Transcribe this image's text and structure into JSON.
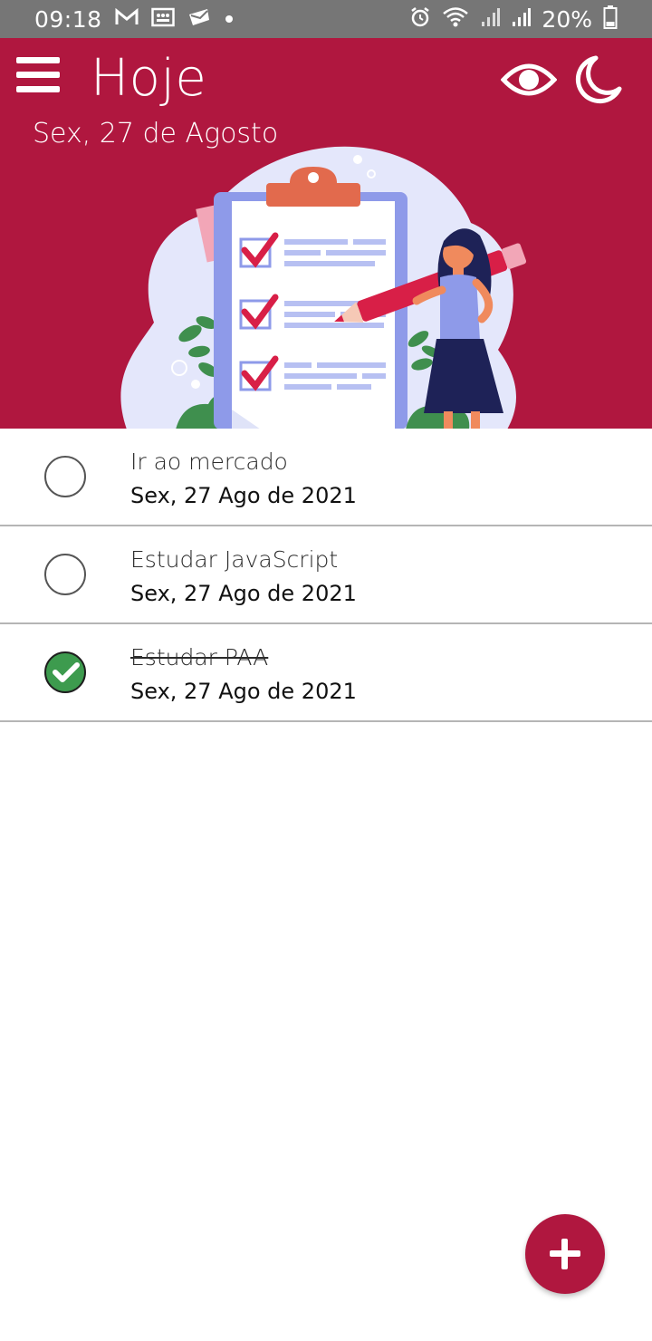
{
  "status_bar": {
    "time": "09:18",
    "battery": "20%",
    "notification_icons": [
      "gmail-icon",
      "photo-icon",
      "message-icon",
      "dot-icon"
    ],
    "system_icons": [
      "alarm-icon",
      "wifi-icon",
      "signal-icon",
      "signal-icon",
      "battery-icon"
    ]
  },
  "header": {
    "title": "Hoje",
    "subtitle": "Sex, 27 de Agosto",
    "actions": [
      "eye-icon",
      "moon-icon"
    ],
    "background_color": "#b0173f"
  },
  "tasks": [
    {
      "title": "Ir ao mercado",
      "date": "Sex, 27 Ago de 2021",
      "done": false
    },
    {
      "title": "Estudar JavaScript",
      "date": "Sex, 27 Ago de 2021",
      "done": false
    },
    {
      "title": "Estudar PAA",
      "date": "Sex, 27 Ago de 2021",
      "done": true
    }
  ],
  "fab": {
    "icon": "plus-icon",
    "color": "#b0173f"
  },
  "colors": {
    "accent": "#b0173f",
    "done_green": "#3d9b4e"
  }
}
